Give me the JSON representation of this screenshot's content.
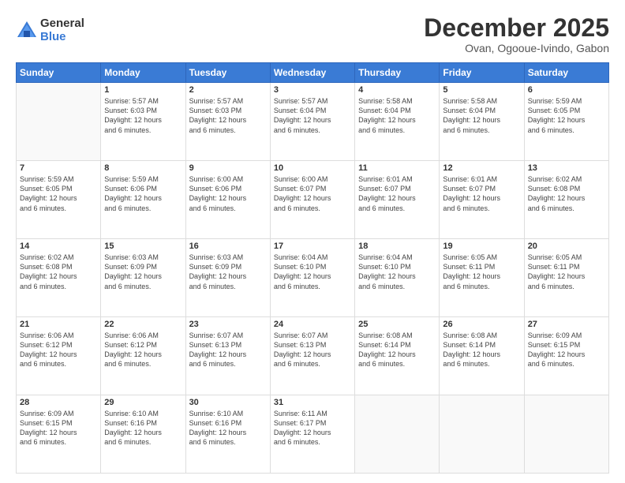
{
  "logo": {
    "general": "General",
    "blue": "Blue"
  },
  "title": "December 2025",
  "location": "Ovan, Ogooue-Ivindo, Gabon",
  "weekdays": [
    "Sunday",
    "Monday",
    "Tuesday",
    "Wednesday",
    "Thursday",
    "Friday",
    "Saturday"
  ],
  "weeks": [
    [
      {
        "day": "",
        "info": ""
      },
      {
        "day": "1",
        "info": "Sunrise: 5:57 AM\nSunset: 6:03 PM\nDaylight: 12 hours\nand 6 minutes."
      },
      {
        "day": "2",
        "info": "Sunrise: 5:57 AM\nSunset: 6:03 PM\nDaylight: 12 hours\nand 6 minutes."
      },
      {
        "day": "3",
        "info": "Sunrise: 5:57 AM\nSunset: 6:04 PM\nDaylight: 12 hours\nand 6 minutes."
      },
      {
        "day": "4",
        "info": "Sunrise: 5:58 AM\nSunset: 6:04 PM\nDaylight: 12 hours\nand 6 minutes."
      },
      {
        "day": "5",
        "info": "Sunrise: 5:58 AM\nSunset: 6:04 PM\nDaylight: 12 hours\nand 6 minutes."
      },
      {
        "day": "6",
        "info": "Sunrise: 5:59 AM\nSunset: 6:05 PM\nDaylight: 12 hours\nand 6 minutes."
      }
    ],
    [
      {
        "day": "7",
        "info": "Sunrise: 5:59 AM\nSunset: 6:05 PM\nDaylight: 12 hours\nand 6 minutes."
      },
      {
        "day": "8",
        "info": "Sunrise: 5:59 AM\nSunset: 6:06 PM\nDaylight: 12 hours\nand 6 minutes."
      },
      {
        "day": "9",
        "info": "Sunrise: 6:00 AM\nSunset: 6:06 PM\nDaylight: 12 hours\nand 6 minutes."
      },
      {
        "day": "10",
        "info": "Sunrise: 6:00 AM\nSunset: 6:07 PM\nDaylight: 12 hours\nand 6 minutes."
      },
      {
        "day": "11",
        "info": "Sunrise: 6:01 AM\nSunset: 6:07 PM\nDaylight: 12 hours\nand 6 minutes."
      },
      {
        "day": "12",
        "info": "Sunrise: 6:01 AM\nSunset: 6:07 PM\nDaylight: 12 hours\nand 6 minutes."
      },
      {
        "day": "13",
        "info": "Sunrise: 6:02 AM\nSunset: 6:08 PM\nDaylight: 12 hours\nand 6 minutes."
      }
    ],
    [
      {
        "day": "14",
        "info": "Sunrise: 6:02 AM\nSunset: 6:08 PM\nDaylight: 12 hours\nand 6 minutes."
      },
      {
        "day": "15",
        "info": "Sunrise: 6:03 AM\nSunset: 6:09 PM\nDaylight: 12 hours\nand 6 minutes."
      },
      {
        "day": "16",
        "info": "Sunrise: 6:03 AM\nSunset: 6:09 PM\nDaylight: 12 hours\nand 6 minutes."
      },
      {
        "day": "17",
        "info": "Sunrise: 6:04 AM\nSunset: 6:10 PM\nDaylight: 12 hours\nand 6 minutes."
      },
      {
        "day": "18",
        "info": "Sunrise: 6:04 AM\nSunset: 6:10 PM\nDaylight: 12 hours\nand 6 minutes."
      },
      {
        "day": "19",
        "info": "Sunrise: 6:05 AM\nSunset: 6:11 PM\nDaylight: 12 hours\nand 6 minutes."
      },
      {
        "day": "20",
        "info": "Sunrise: 6:05 AM\nSunset: 6:11 PM\nDaylight: 12 hours\nand 6 minutes."
      }
    ],
    [
      {
        "day": "21",
        "info": "Sunrise: 6:06 AM\nSunset: 6:12 PM\nDaylight: 12 hours\nand 6 minutes."
      },
      {
        "day": "22",
        "info": "Sunrise: 6:06 AM\nSunset: 6:12 PM\nDaylight: 12 hours\nand 6 minutes."
      },
      {
        "day": "23",
        "info": "Sunrise: 6:07 AM\nSunset: 6:13 PM\nDaylight: 12 hours\nand 6 minutes."
      },
      {
        "day": "24",
        "info": "Sunrise: 6:07 AM\nSunset: 6:13 PM\nDaylight: 12 hours\nand 6 minutes."
      },
      {
        "day": "25",
        "info": "Sunrise: 6:08 AM\nSunset: 6:14 PM\nDaylight: 12 hours\nand 6 minutes."
      },
      {
        "day": "26",
        "info": "Sunrise: 6:08 AM\nSunset: 6:14 PM\nDaylight: 12 hours\nand 6 minutes."
      },
      {
        "day": "27",
        "info": "Sunrise: 6:09 AM\nSunset: 6:15 PM\nDaylight: 12 hours\nand 6 minutes."
      }
    ],
    [
      {
        "day": "28",
        "info": "Sunrise: 6:09 AM\nSunset: 6:15 PM\nDaylight: 12 hours\nand 6 minutes."
      },
      {
        "day": "29",
        "info": "Sunrise: 6:10 AM\nSunset: 6:16 PM\nDaylight: 12 hours\nand 6 minutes."
      },
      {
        "day": "30",
        "info": "Sunrise: 6:10 AM\nSunset: 6:16 PM\nDaylight: 12 hours\nand 6 minutes."
      },
      {
        "day": "31",
        "info": "Sunrise: 6:11 AM\nSunset: 6:17 PM\nDaylight: 12 hours\nand 6 minutes."
      },
      {
        "day": "",
        "info": ""
      },
      {
        "day": "",
        "info": ""
      },
      {
        "day": "",
        "info": ""
      }
    ]
  ]
}
